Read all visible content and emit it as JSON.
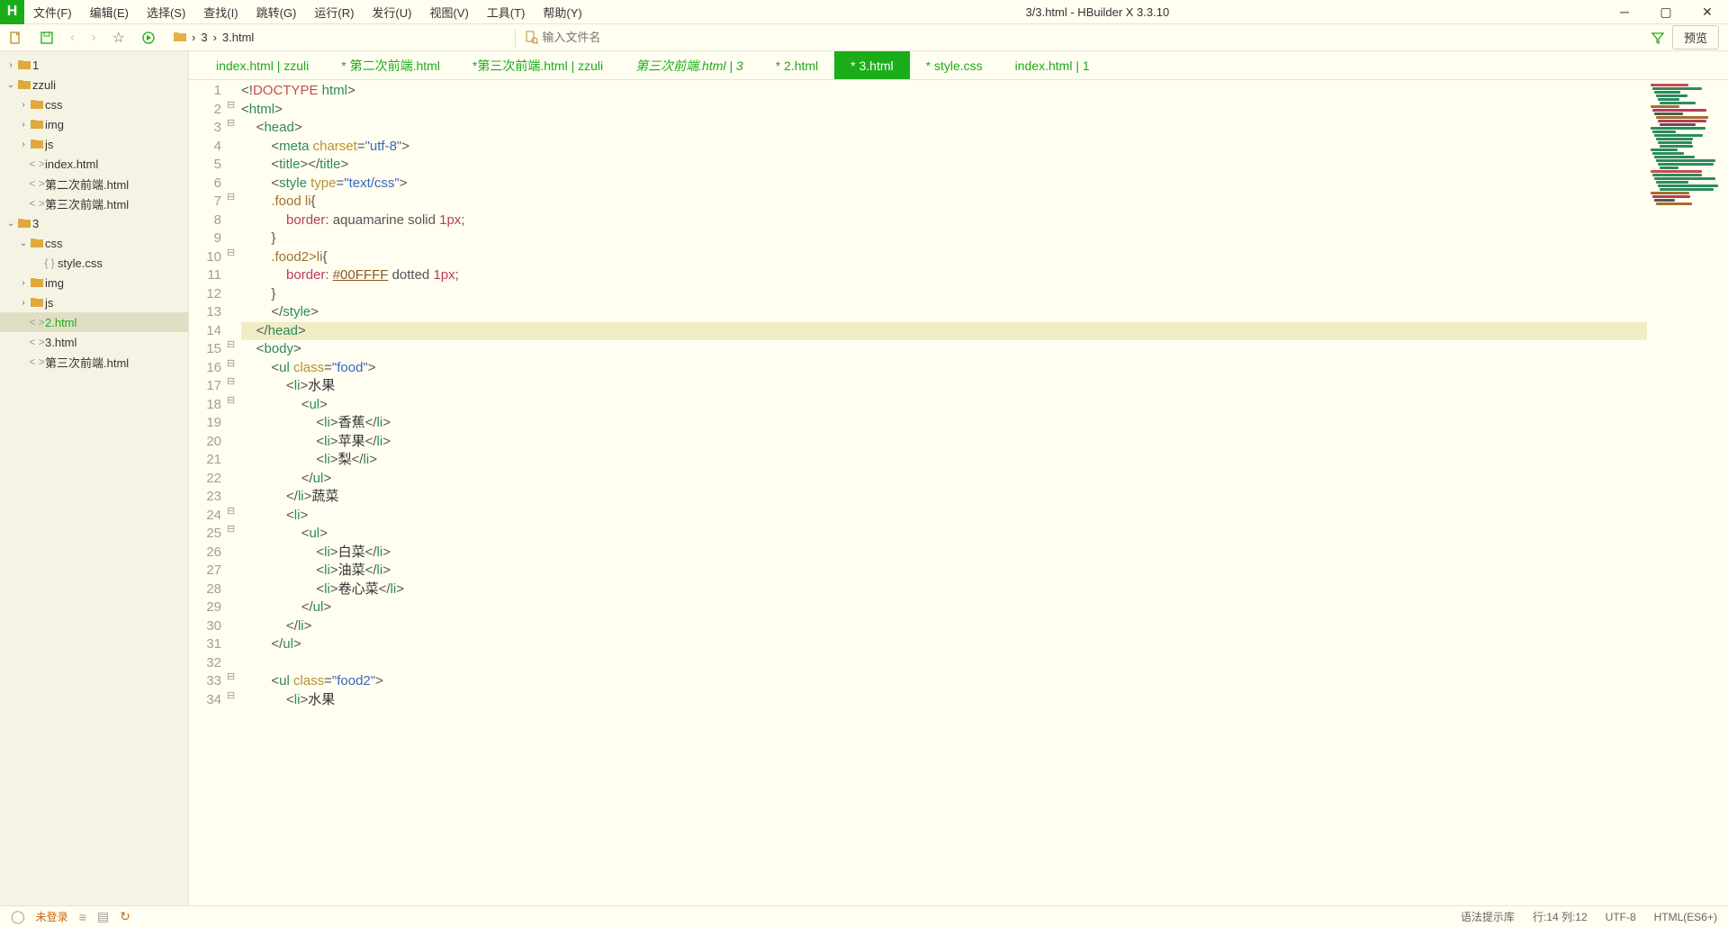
{
  "title": "3/3.html - HBuilder X 3.3.10",
  "menu": [
    "文件(F)",
    "编辑(E)",
    "选择(S)",
    "查找(I)",
    "跳转(G)",
    "运行(R)",
    "发行(U)",
    "视图(V)",
    "工具(T)",
    "帮助(Y)"
  ],
  "breadcrumb": {
    "a": "3",
    "b": "3.html"
  },
  "search_placeholder": "输入文件名",
  "preview_label": "预览",
  "tree": [
    {
      "depth": 0,
      "arrow": "›",
      "icon": "folder",
      "label": "1"
    },
    {
      "depth": 0,
      "arrow": "⌄",
      "icon": "folder",
      "label": "zzuli"
    },
    {
      "depth": 1,
      "arrow": "›",
      "icon": "folder",
      "label": "css"
    },
    {
      "depth": 1,
      "arrow": "›",
      "icon": "folder",
      "label": "img"
    },
    {
      "depth": 1,
      "arrow": "›",
      "icon": "folder",
      "label": "js"
    },
    {
      "depth": 1,
      "arrow": "",
      "icon": "html",
      "label": "index.html"
    },
    {
      "depth": 1,
      "arrow": "",
      "icon": "html",
      "label": "第二次前端.html"
    },
    {
      "depth": 1,
      "arrow": "",
      "icon": "html",
      "label": "第三次前端.html"
    },
    {
      "depth": 0,
      "arrow": "⌄",
      "icon": "folder",
      "label": "3"
    },
    {
      "depth": 1,
      "arrow": "⌄",
      "icon": "folder",
      "label": "css"
    },
    {
      "depth": 2,
      "arrow": "",
      "icon": "css",
      "label": "style.css"
    },
    {
      "depth": 1,
      "arrow": "›",
      "icon": "folder",
      "label": "img"
    },
    {
      "depth": 1,
      "arrow": "›",
      "icon": "folder",
      "label": "js"
    },
    {
      "depth": 1,
      "arrow": "",
      "icon": "html",
      "label": "2.html",
      "active": true,
      "selected": true
    },
    {
      "depth": 1,
      "arrow": "",
      "icon": "html",
      "label": "3.html"
    },
    {
      "depth": 1,
      "arrow": "",
      "icon": "html",
      "label": "第三次前端.html"
    }
  ],
  "tabs": [
    {
      "label": "index.html | zzuli",
      "style": "green"
    },
    {
      "label": "* 第二次前端.html",
      "style": "green"
    },
    {
      "label": "*第三次前端.html | zzuli",
      "style": "green"
    },
    {
      "label": "第三次前端.html | 3",
      "style": "italic"
    },
    {
      "label": "* 2.html",
      "style": "green"
    },
    {
      "label": "* 3.html",
      "style": "active"
    },
    {
      "label": "* style.css",
      "style": "green"
    },
    {
      "label": "index.html | 1",
      "style": "green"
    }
  ],
  "code_lines": [
    {
      "n": 1,
      "fold": "",
      "hl": false,
      "segs": [
        [
          "<!",
          "punc"
        ],
        [
          "DOCTYPE ",
          "decl"
        ],
        [
          "html",
          "tag"
        ],
        [
          ">",
          "punc"
        ]
      ]
    },
    {
      "n": 2,
      "fold": "⊟",
      "hl": false,
      "segs": [
        [
          "<",
          "punc"
        ],
        [
          "html",
          "tag"
        ],
        [
          ">",
          "punc"
        ]
      ]
    },
    {
      "n": 3,
      "fold": "⊟",
      "hl": false,
      "segs": [
        [
          "    ",
          "ws"
        ],
        [
          "<",
          "punc"
        ],
        [
          "head",
          "tag"
        ],
        [
          ">",
          "punc"
        ]
      ]
    },
    {
      "n": 4,
      "fold": "",
      "hl": false,
      "segs": [
        [
          "        ",
          "ws"
        ],
        [
          "<",
          "punc"
        ],
        [
          "meta ",
          "tag"
        ],
        [
          "charset",
          "attr"
        ],
        [
          "=",
          "punc"
        ],
        [
          "\"utf-8\"",
          "str"
        ],
        [
          ">",
          "punc"
        ]
      ]
    },
    {
      "n": 5,
      "fold": "",
      "hl": false,
      "segs": [
        [
          "        ",
          "ws"
        ],
        [
          "<",
          "punc"
        ],
        [
          "title",
          "tag"
        ],
        [
          "></",
          "punc"
        ],
        [
          "title",
          "tag"
        ],
        [
          ">",
          "punc"
        ]
      ]
    },
    {
      "n": 6,
      "fold": "",
      "hl": false,
      "segs": [
        [
          "        ",
          "ws"
        ],
        [
          "<",
          "punc"
        ],
        [
          "style ",
          "tag"
        ],
        [
          "type",
          "attr"
        ],
        [
          "=",
          "punc"
        ],
        [
          "\"text/css\"",
          "str"
        ],
        [
          ">",
          "punc"
        ]
      ]
    },
    {
      "n": 7,
      "fold": "⊟",
      "hl": false,
      "segs": [
        [
          "        ",
          "ws"
        ],
        [
          ".food li",
          "sel"
        ],
        [
          "{",
          "punc"
        ]
      ]
    },
    {
      "n": 8,
      "fold": "",
      "hl": false,
      "segs": [
        [
          "            ",
          "ws"
        ],
        [
          "border",
          "prop"
        ],
        [
          ": ",
          "punc"
        ],
        [
          "aquamarine solid ",
          "val"
        ],
        [
          "1px",
          "num"
        ],
        [
          ";",
          "punc"
        ]
      ]
    },
    {
      "n": 9,
      "fold": "",
      "hl": false,
      "segs": [
        [
          "        ",
          "ws"
        ],
        [
          "}",
          "punc"
        ]
      ]
    },
    {
      "n": 10,
      "fold": "⊟",
      "hl": false,
      "segs": [
        [
          "        ",
          "ws"
        ],
        [
          ".food2>li",
          "sel"
        ],
        [
          "{",
          "punc"
        ]
      ]
    },
    {
      "n": 11,
      "fold": "",
      "hl": false,
      "segs": [
        [
          "            ",
          "ws"
        ],
        [
          "border",
          "prop"
        ],
        [
          ": ",
          "punc"
        ],
        [
          "#00FFFF",
          "hex"
        ],
        [
          " dotted ",
          "val"
        ],
        [
          "1px",
          "num"
        ],
        [
          ";",
          "punc"
        ]
      ]
    },
    {
      "n": 12,
      "fold": "",
      "hl": false,
      "segs": [
        [
          "        ",
          "ws"
        ],
        [
          "}",
          "punc"
        ]
      ]
    },
    {
      "n": 13,
      "fold": "",
      "hl": false,
      "segs": [
        [
          "        ",
          "ws"
        ],
        [
          "</",
          "punc"
        ],
        [
          "style",
          "tag"
        ],
        [
          ">",
          "punc"
        ]
      ]
    },
    {
      "n": 14,
      "fold": "",
      "hl": true,
      "segs": [
        [
          "    ",
          "ws"
        ],
        [
          "</",
          "punc"
        ],
        [
          "head",
          "tag"
        ],
        [
          ">",
          "punc"
        ]
      ]
    },
    {
      "n": 15,
      "fold": "⊟",
      "hl": false,
      "segs": [
        [
          "    ",
          "ws"
        ],
        [
          "<",
          "punc"
        ],
        [
          "body",
          "tag"
        ],
        [
          ">",
          "punc"
        ]
      ]
    },
    {
      "n": 16,
      "fold": "⊟",
      "hl": false,
      "segs": [
        [
          "        ",
          "ws"
        ],
        [
          "<",
          "punc"
        ],
        [
          "ul ",
          "tag"
        ],
        [
          "class",
          "attr"
        ],
        [
          "=",
          "punc"
        ],
        [
          "\"food\"",
          "str"
        ],
        [
          ">",
          "punc"
        ]
      ]
    },
    {
      "n": 17,
      "fold": "⊟",
      "hl": false,
      "segs": [
        [
          "            ",
          "ws"
        ],
        [
          "<",
          "punc"
        ],
        [
          "li",
          "tag"
        ],
        [
          ">",
          "punc"
        ],
        [
          "水果",
          "text"
        ]
      ]
    },
    {
      "n": 18,
      "fold": "⊟",
      "hl": false,
      "segs": [
        [
          "                ",
          "ws"
        ],
        [
          "<",
          "punc"
        ],
        [
          "ul",
          "tag"
        ],
        [
          ">",
          "punc"
        ]
      ]
    },
    {
      "n": 19,
      "fold": "",
      "hl": false,
      "segs": [
        [
          "                    ",
          "ws"
        ],
        [
          "<",
          "punc"
        ],
        [
          "li",
          "tag"
        ],
        [
          ">",
          "punc"
        ],
        [
          "香蕉",
          "text"
        ],
        [
          "</",
          "punc"
        ],
        [
          "li",
          "tag"
        ],
        [
          ">",
          "punc"
        ]
      ]
    },
    {
      "n": 20,
      "fold": "",
      "hl": false,
      "segs": [
        [
          "                    ",
          "ws"
        ],
        [
          "<",
          "punc"
        ],
        [
          "li",
          "tag"
        ],
        [
          ">",
          "punc"
        ],
        [
          "苹果",
          "text"
        ],
        [
          "</",
          "punc"
        ],
        [
          "li",
          "tag"
        ],
        [
          ">",
          "punc"
        ]
      ]
    },
    {
      "n": 21,
      "fold": "",
      "hl": false,
      "segs": [
        [
          "                    ",
          "ws"
        ],
        [
          "<",
          "punc"
        ],
        [
          "li",
          "tag"
        ],
        [
          ">",
          "punc"
        ],
        [
          "梨",
          "text"
        ],
        [
          "</",
          "punc"
        ],
        [
          "li",
          "tag"
        ],
        [
          ">",
          "punc"
        ]
      ]
    },
    {
      "n": 22,
      "fold": "",
      "hl": false,
      "segs": [
        [
          "                ",
          "ws"
        ],
        [
          "</",
          "punc"
        ],
        [
          "ul",
          "tag"
        ],
        [
          ">",
          "punc"
        ]
      ]
    },
    {
      "n": 23,
      "fold": "",
      "hl": false,
      "segs": [
        [
          "            ",
          "ws"
        ],
        [
          "</",
          "punc"
        ],
        [
          "li",
          "tag"
        ],
        [
          ">",
          "punc"
        ],
        [
          "蔬菜",
          "text"
        ]
      ]
    },
    {
      "n": 24,
      "fold": "⊟",
      "hl": false,
      "segs": [
        [
          "            ",
          "ws"
        ],
        [
          "<",
          "punc"
        ],
        [
          "li",
          "tag"
        ],
        [
          ">",
          "punc"
        ]
      ]
    },
    {
      "n": 25,
      "fold": "⊟",
      "hl": false,
      "segs": [
        [
          "                ",
          "ws"
        ],
        [
          "<",
          "punc"
        ],
        [
          "ul",
          "tag"
        ],
        [
          ">",
          "punc"
        ]
      ]
    },
    {
      "n": 26,
      "fold": "",
      "hl": false,
      "segs": [
        [
          "                    ",
          "ws"
        ],
        [
          "<",
          "punc"
        ],
        [
          "li",
          "tag"
        ],
        [
          ">",
          "punc"
        ],
        [
          "白菜",
          "text"
        ],
        [
          "</",
          "punc"
        ],
        [
          "li",
          "tag"
        ],
        [
          ">",
          "punc"
        ]
      ]
    },
    {
      "n": 27,
      "fold": "",
      "hl": false,
      "segs": [
        [
          "                    ",
          "ws"
        ],
        [
          "<",
          "punc"
        ],
        [
          "li",
          "tag"
        ],
        [
          ">",
          "punc"
        ],
        [
          "油菜",
          "text"
        ],
        [
          "</",
          "punc"
        ],
        [
          "li",
          "tag"
        ],
        [
          ">",
          "punc"
        ]
      ]
    },
    {
      "n": 28,
      "fold": "",
      "hl": false,
      "segs": [
        [
          "                    ",
          "ws"
        ],
        [
          "<",
          "punc"
        ],
        [
          "li",
          "tag"
        ],
        [
          ">",
          "punc"
        ],
        [
          "卷心菜",
          "text"
        ],
        [
          "</",
          "punc"
        ],
        [
          "li",
          "tag"
        ],
        [
          ">",
          "punc"
        ]
      ]
    },
    {
      "n": 29,
      "fold": "",
      "hl": false,
      "segs": [
        [
          "                ",
          "ws"
        ],
        [
          "</",
          "punc"
        ],
        [
          "ul",
          "tag"
        ],
        [
          ">",
          "punc"
        ]
      ]
    },
    {
      "n": 30,
      "fold": "",
      "hl": false,
      "segs": [
        [
          "            ",
          "ws"
        ],
        [
          "</",
          "punc"
        ],
        [
          "li",
          "tag"
        ],
        [
          ">",
          "punc"
        ]
      ]
    },
    {
      "n": 31,
      "fold": "",
      "hl": false,
      "segs": [
        [
          "        ",
          "ws"
        ],
        [
          "</",
          "punc"
        ],
        [
          "ul",
          "tag"
        ],
        [
          ">",
          "punc"
        ]
      ]
    },
    {
      "n": 32,
      "fold": "",
      "hl": false,
      "segs": []
    },
    {
      "n": 33,
      "fold": "⊟",
      "hl": false,
      "segs": [
        [
          "        ",
          "ws"
        ],
        [
          "<",
          "punc"
        ],
        [
          "ul ",
          "tag"
        ],
        [
          "class",
          "attr"
        ],
        [
          "=",
          "punc"
        ],
        [
          "\"food2\"",
          "str"
        ],
        [
          ">",
          "punc"
        ]
      ]
    },
    {
      "n": 34,
      "fold": "⊟",
      "hl": false,
      "segs": [
        [
          "            ",
          "ws"
        ],
        [
          "<",
          "punc"
        ],
        [
          "li",
          "tag"
        ],
        [
          ">",
          "punc"
        ],
        [
          "水果",
          "text"
        ]
      ]
    }
  ],
  "status": {
    "login": "未登录",
    "syntax": "语法提示库",
    "pos": "行:14 列:12",
    "encoding": "UTF-8",
    "lang": "HTML(ES6+)"
  }
}
